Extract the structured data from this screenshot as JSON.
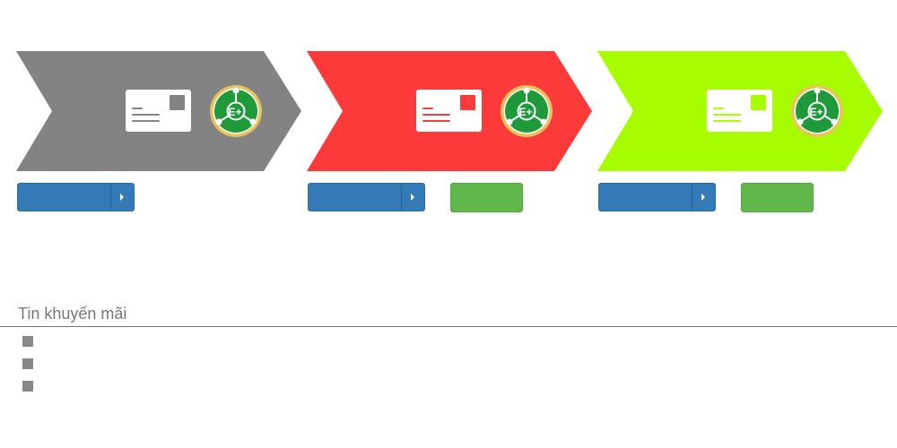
{
  "cards": [
    {
      "color": "#838383",
      "label": "",
      "split_button_label": "",
      "has_green_button": false,
      "green_button_label": ""
    },
    {
      "color": "#fd3a3a",
      "label": "",
      "split_button_label": "",
      "has_green_button": true,
      "green_button_label": ""
    },
    {
      "color": "#a8fc00",
      "label": "",
      "split_button_label": "",
      "has_green_button": true,
      "green_button_label": ""
    }
  ],
  "logo": {
    "icon": "e-plus-molecule-logo-icon",
    "text": "E+",
    "colors": {
      "ring": "#e7c35a",
      "disc": "#1f9a3b",
      "lines": "#ffffff"
    }
  },
  "colors": {
    "primary_button": "#337ab7",
    "success_button": "#62b74c",
    "id_card_fill": "#ffffff"
  },
  "promotions": {
    "title": "Tin khuyến mãi",
    "items": [
      "",
      "",
      ""
    ]
  }
}
